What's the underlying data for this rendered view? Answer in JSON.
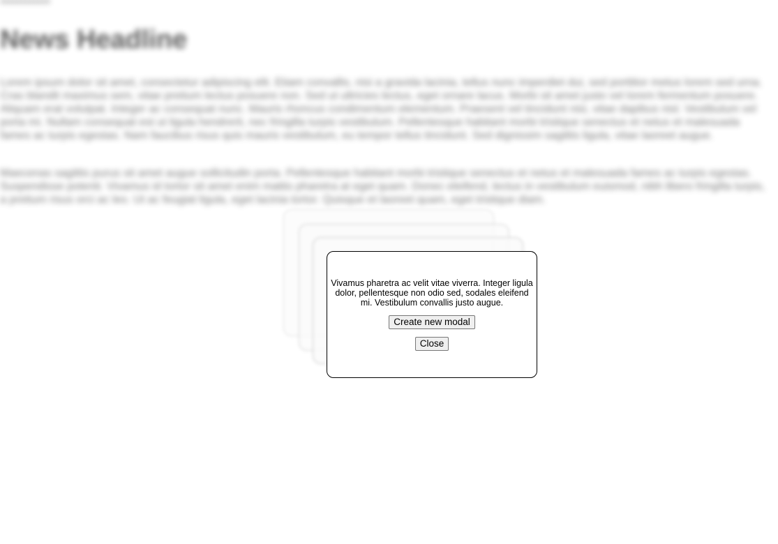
{
  "background_page": {
    "kicker": "xxxxxxxxxxxx",
    "headline": "News Headline",
    "paragraphs": [
      "Lorem ipsum dolor sit amet, consectetur adipiscing elit. Etiam convallis, nisi a gravida lacinia, tellus nunc imperdiet dui, sed porttitor metus lorem sed urna. Cras blandit maximus sem, vitae pretium lectus posuere non. Sed ut ultricies lectus, eget ornare lacus. Morbi sit amet justo vel lorem fermentum posuere. Aliquam erat volutpat. Integer ac consequat nunc. Mauris rhoncus condimentum elementum. Praesent vel tincidunt nisi, vitae dapibus nisl. Vestibulum vel porta mi. Nullam consequat est ut ligula hendrerit, nec fringilla turpis vestibulum. Pellentesque habitant morbi tristique senectus et netus et malesuada fames ac turpis egestas. Nam faucibus risus quis mauris vestibulum, eu tempor tellus tincidunt. Sed dignissim sagittis ligula, vitae laoreet augue.",
      "Maecenas sagittis purus sit amet augue sollicitudin porta. Pellentesque habitant morbi tristique senectus et netus et malesuada fames ac turpis egestas. Suspendisse potenti. Vivamus id tortor sit amet enim mattis pharetra at eget quam. Donec eleifend, lectus in vestibulum euismod, nibh libero fringilla turpis, a pretium risus orci ac leo. Ut ac feugiat ligula, eget lacinia tortor. Quisque et laoreet quam, eget tristique diam."
    ]
  },
  "modal": {
    "text": "Vivamus pharetra ac velit vitae viverra. Integer ligula dolor, pellentesque non odio sed, sodales eleifend mi. Vestibulum convallis justo augue.",
    "create_button_label": "Create new modal",
    "close_button_label": "Close"
  },
  "colors": {
    "modal_border": "#000000",
    "modal_background": "#ffffff",
    "button_background": "#efefef",
    "button_border": "#767676"
  }
}
